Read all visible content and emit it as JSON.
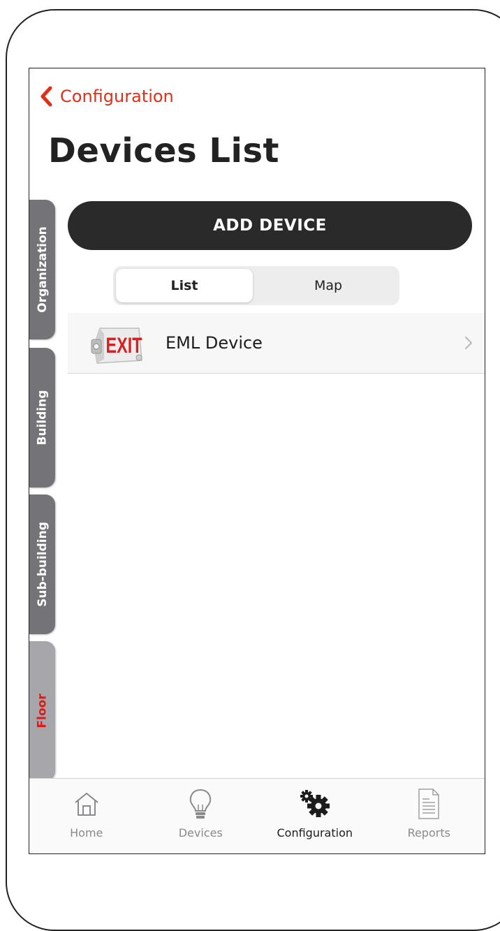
{
  "header": {
    "back_label": "Configuration",
    "title": "Devices List"
  },
  "side_tabs": [
    {
      "label": "Organization",
      "active": false
    },
    {
      "label": "Building",
      "active": false
    },
    {
      "label": "Sub-building",
      "active": false
    },
    {
      "label": "Floor",
      "active": true
    }
  ],
  "actions": {
    "add_device_label": "ADD DEVICE"
  },
  "view_toggle": {
    "options": [
      "List",
      "Map"
    ],
    "selected": "List"
  },
  "devices": [
    {
      "name": "EML Device",
      "icon": "exit-sign-icon",
      "thumb_text": "EXIT"
    }
  ],
  "tabbar": {
    "items": [
      {
        "label": "Home",
        "icon": "home-icon"
      },
      {
        "label": "Devices",
        "icon": "lightbulb-icon"
      },
      {
        "label": "Configuration",
        "icon": "gears-icon"
      },
      {
        "label": "Reports",
        "icon": "report-icon"
      }
    ],
    "active": "Configuration"
  },
  "colors": {
    "accent": "#e03018",
    "button_dark": "#2a2a2a",
    "tab_gray": "#737378",
    "tab_active_bg": "#a6a6ab",
    "tab_active_text": "#e01818"
  }
}
